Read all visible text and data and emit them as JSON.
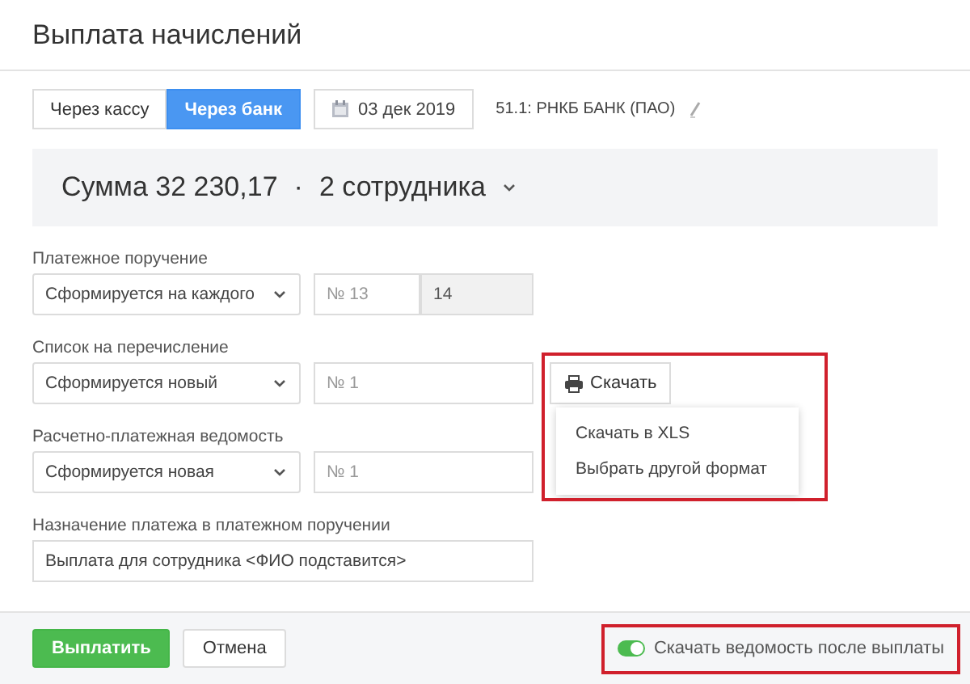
{
  "window": {
    "title": "Выплата начислений"
  },
  "tabs": [
    {
      "label": "Через кассу",
      "selected": false
    },
    {
      "label": "Через банк",
      "selected": true
    }
  ],
  "date": "03 дек 2019",
  "account": "51.1: РНКБ БАНК (ПАО)",
  "summary": {
    "sum": "Сумма 32 230,17",
    "separator": "·",
    "employees": "2 сотрудника"
  },
  "sections": [
    {
      "label": "Платежное поручение",
      "select": "Сформируется на каждого",
      "number": "№ 13",
      "number_to": "14"
    },
    {
      "label": "Список на перечисление",
      "select": "Сформируется новый",
      "number": "№ 1",
      "download": {
        "button": "Скачать",
        "menu": [
          "Скачать в XLS",
          "Выбрать другой формат"
        ]
      }
    },
    {
      "label": "Расчетно-платежная ведомость",
      "select": "Сформируется новая",
      "number": "№ 1"
    }
  ],
  "purpose": {
    "label": "Назначение платежа в платежном поручении",
    "value": "Выплата для сотрудника <ФИО подставится>"
  },
  "footer": {
    "buttons": [
      {
        "label": "Выплатить",
        "kind": "primary"
      },
      {
        "label": "Отмена",
        "kind": "secondary"
      }
    ],
    "toggle": {
      "label": "Скачать ведомость после выплаты",
      "on": true
    }
  }
}
